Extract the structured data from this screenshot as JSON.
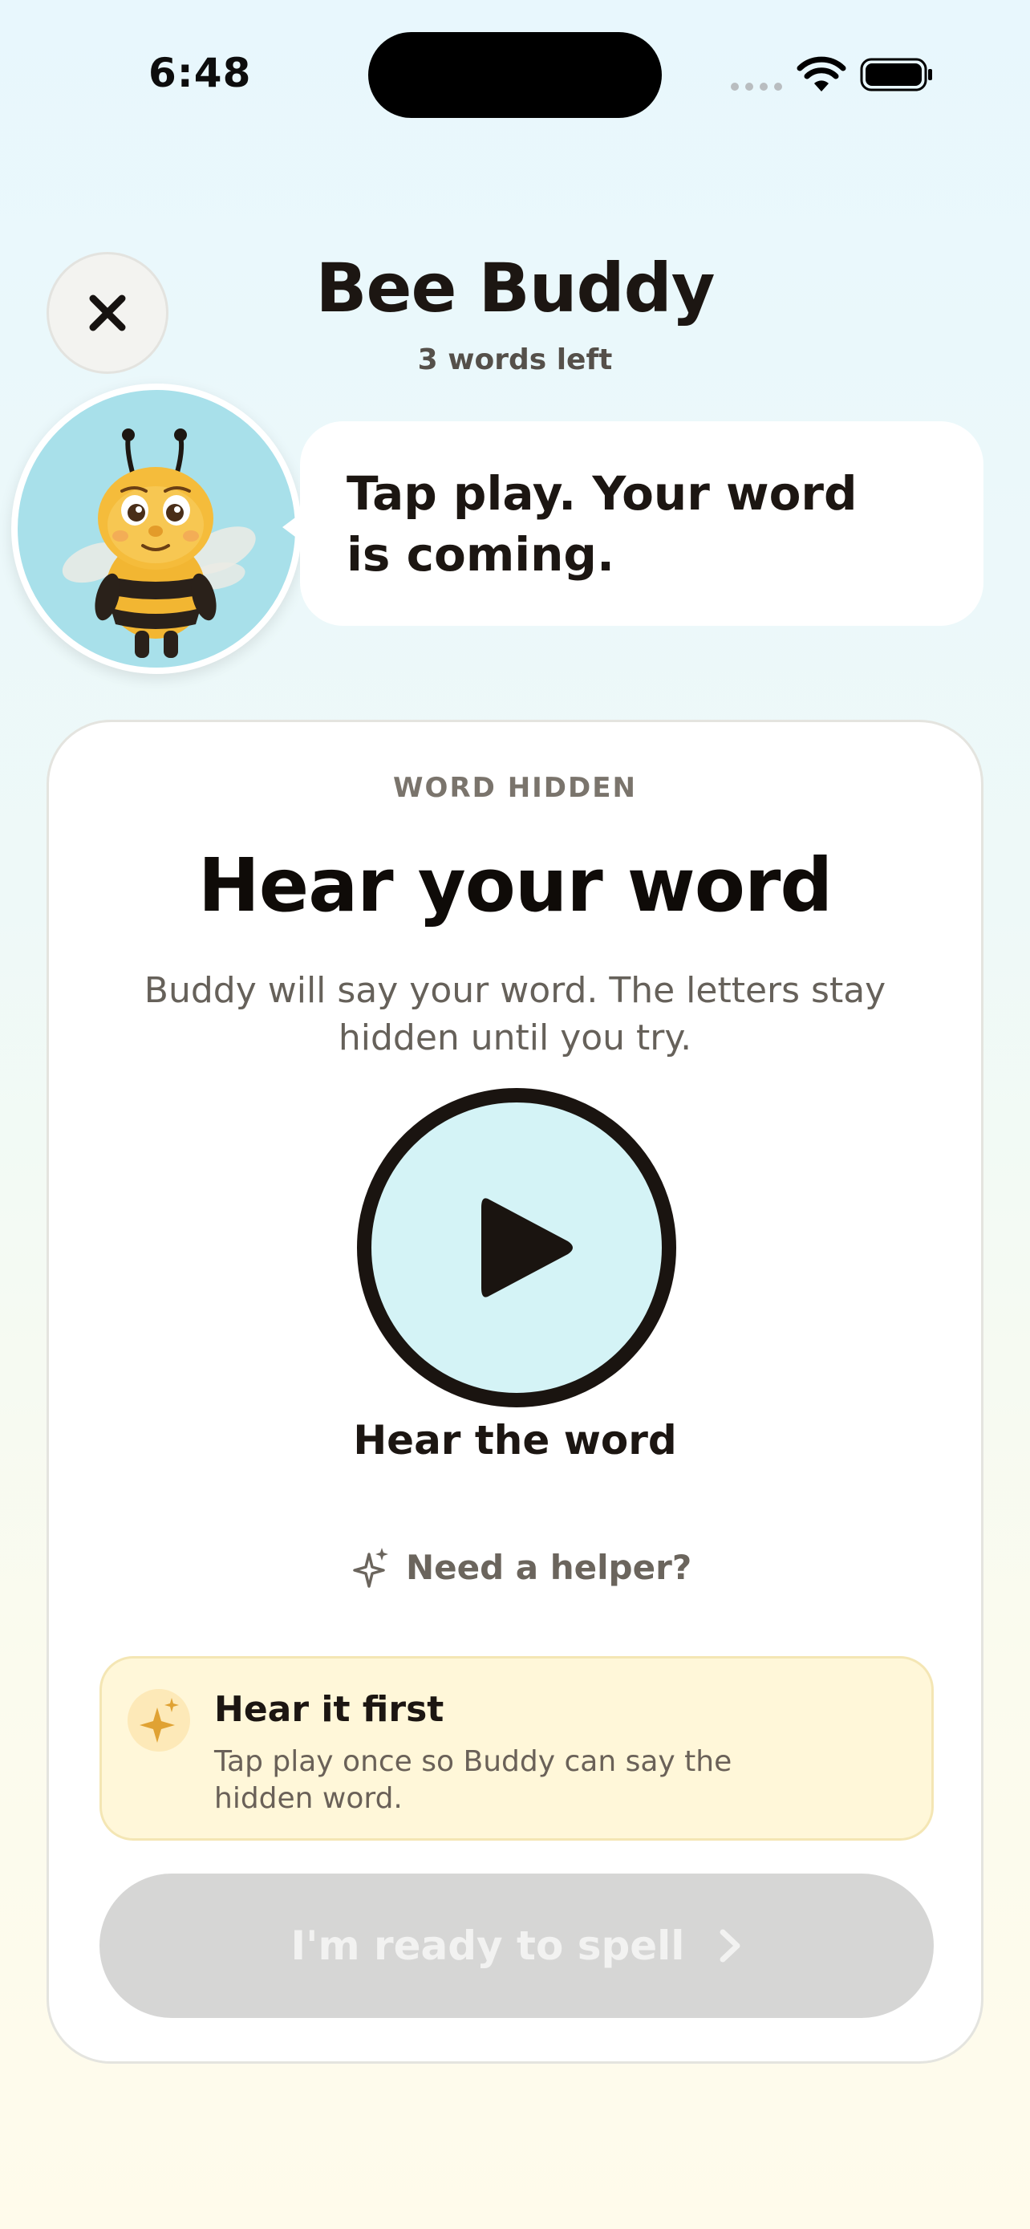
{
  "status_bar": {
    "time": "6:48"
  },
  "header": {
    "title": "Bee Buddy",
    "subtitle": "3 words left",
    "close_icon": "close-icon"
  },
  "mascot": {
    "speech": "Tap play. Your word is coming.",
    "background_color": "#a8e0ea"
  },
  "card": {
    "eyebrow": "WORD HIDDEN",
    "title": "Hear your word",
    "description": "Buddy will say your word. The letters stay hidden until you try.",
    "play_label": "Hear the word",
    "play_icon": "play-icon",
    "helper_label": "Need a helper?",
    "helper_icon": "sparkle-icon",
    "tip": {
      "title": "Hear it first",
      "body": "Tap play once so Buddy can say the hidden word.",
      "icon": "sparkle-icon"
    },
    "ready_button": {
      "label": "I'm ready to spell",
      "icon": "chevron-right-icon",
      "state": "disabled"
    }
  },
  "colors": {
    "play_fill": "#d4f3f6",
    "tip_background": "#fff7d9",
    "accent_gold": "#e0a233",
    "disabled_button": "#d6d6d5"
  }
}
